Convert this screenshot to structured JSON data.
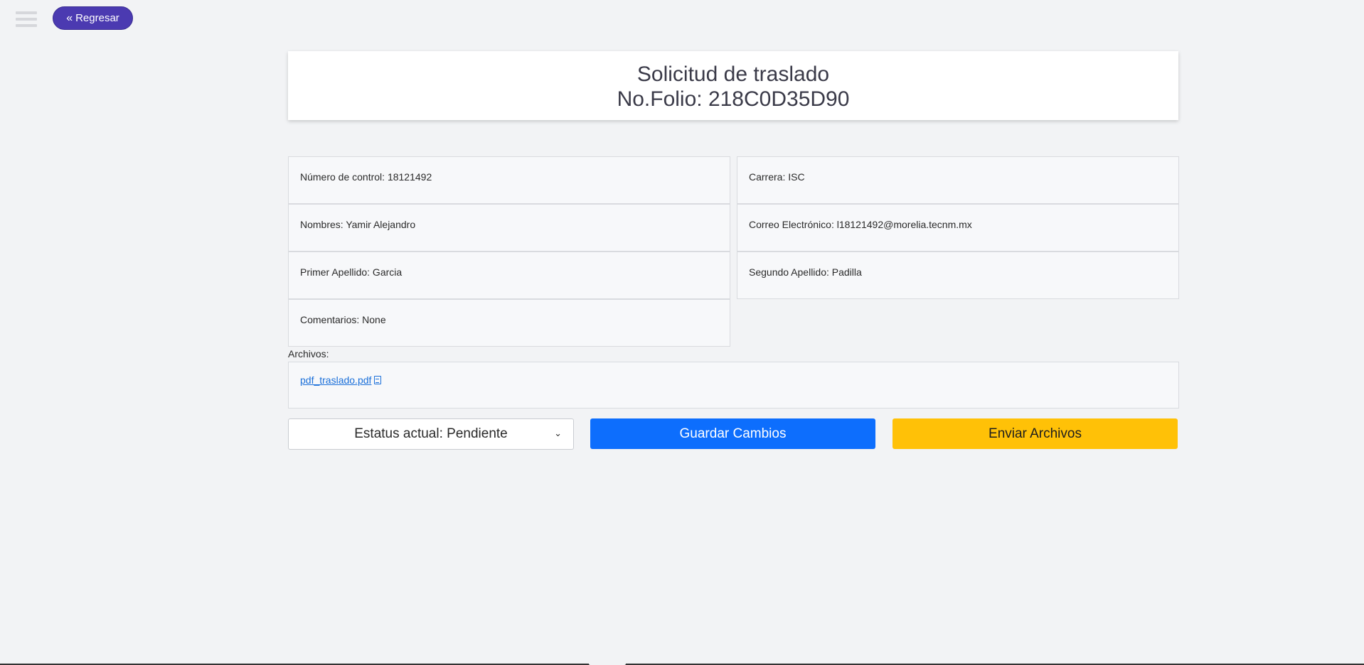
{
  "header": {
    "menu_icon": "hamburger-menu-icon",
    "back_button_label": "Regresar",
    "back_icon": "double-chevron-left-icon"
  },
  "title": {
    "line1": "Solicitud de traslado",
    "line2": "No.Folio: 218C0D35D90"
  },
  "fields": {
    "control": "Número de control: 18121492",
    "carrera": "Carrera: ISC",
    "nombres": "Nombres: Yamir Alejandro",
    "correo": "Correo Electrónico: l18121492@morelia.tecnm.mx",
    "primer_apellido": "Primer Apellido: Garcia",
    "segundo_apellido": "Segundo Apellido: Padilla",
    "comentarios": "Comentarios: None"
  },
  "files": {
    "label": "Archivos:",
    "items": [
      {
        "name": "pdf_traslado.pdf",
        "icon": "pdf-file-icon"
      }
    ]
  },
  "actions": {
    "status_value": "Estatus actual: Pendiente",
    "save_label": "Guardar Cambios",
    "send_label": "Enviar Archivos",
    "colors": {
      "save": "#0d6efd",
      "send": "#ffc107",
      "back": "#4b3ab1"
    }
  }
}
